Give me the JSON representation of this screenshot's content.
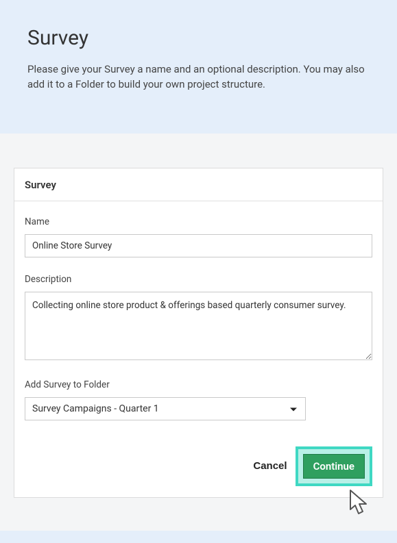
{
  "header": {
    "title": "Survey",
    "subtitle": "Please give your Survey a name and an optional description. You may also add it to a Folder to build your own project structure."
  },
  "card": {
    "title": "Survey"
  },
  "form": {
    "name_label": "Name",
    "name_value": "Online Store Survey",
    "desc_label": "Description",
    "desc_value": "Collecting online store product & offerings based quarterly consumer survey.",
    "folder_label": "Add Survey to Folder",
    "folder_selected": "Survey Campaigns - Quarter 1"
  },
  "actions": {
    "cancel_label": "Cancel",
    "continue_label": "Continue"
  },
  "colors": {
    "accent_green": "#2f9f5f",
    "highlight_teal": "#3fd8c3"
  }
}
